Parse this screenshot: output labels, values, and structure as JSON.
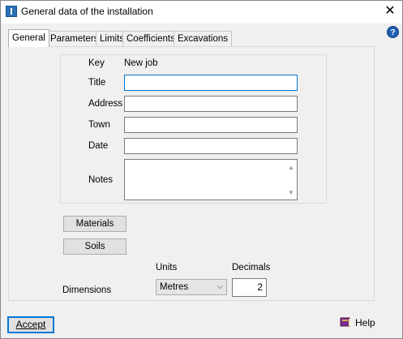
{
  "window": {
    "title": "General data of the installation",
    "close_glyph": "✕",
    "help_glyph": "?"
  },
  "tabs": [
    "General",
    "Parameters",
    "Limits",
    "Coefficients",
    "Excavations"
  ],
  "form": {
    "key_label": "Key",
    "key_value": "New job",
    "title_label": "Title",
    "title_value": "",
    "address_label": "Address",
    "address_value": "",
    "town_label": "Town",
    "town_value": "",
    "date_label": "Date",
    "date_value": "",
    "notes_label": "Notes",
    "notes_value": ""
  },
  "buttons": {
    "materials": "Materials",
    "soils": "Soils",
    "accept": "Accept",
    "help": "Help"
  },
  "dimensions": {
    "label": "Dimensions",
    "units_label": "Units",
    "units_value": "Metres",
    "decimals_label": "Decimals",
    "decimals_value": "2"
  },
  "colors": {
    "accent": "#0078d7",
    "help_icon": "#1f5fb4"
  },
  "icons": {
    "app": "app-icon",
    "close": "close-icon",
    "help": "help-icon",
    "book": "book-icon"
  }
}
